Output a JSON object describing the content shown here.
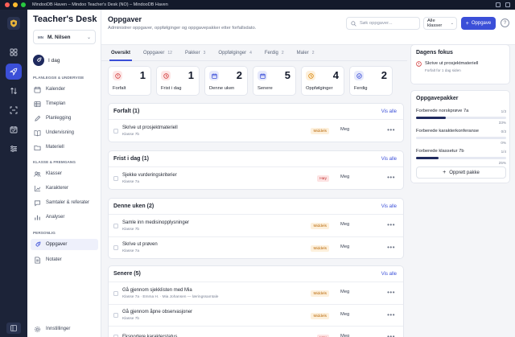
{
  "window": {
    "title": "MindooDB Haven – Mindoo Teacher's Desk (NO) – MindooDB Haven"
  },
  "brand": "Teacher's Desk",
  "user": {
    "initials": "MN",
    "name": "M. Nilsen"
  },
  "rail": {
    "icons": [
      "grid-icon",
      "rocket-icon",
      "arrows-icon",
      "scan-icon",
      "calendar-check-icon",
      "sliders-icon"
    ],
    "active_index": 1
  },
  "sidebar": {
    "today": "I dag",
    "sections": [
      {
        "title": "PLANLEGGE & UNDERVISE",
        "items": [
          "Kalender",
          "Timeplan",
          "Planlegging",
          "Undervisning",
          "Materiell"
        ]
      },
      {
        "title": "KLASSE & FREMGANG",
        "items": [
          "Klasser",
          "Karakterer",
          "Samtaler & referater",
          "Analyser"
        ]
      },
      {
        "title": "PERSONLIG",
        "items": [
          "Oppgaver",
          "Notater"
        ]
      }
    ],
    "active_item": "Oppgaver",
    "settings": "Innstillinger"
  },
  "header": {
    "title": "Oppgaver",
    "subtitle": "Administrer oppgaver, oppfølginger og oppgavepakker etter forfallsdato.",
    "search_placeholder": "Søk oppgaver...",
    "class_filter": "Alle klasser",
    "new_button": "Oppgave"
  },
  "tabs": [
    {
      "label": "Oversikt",
      "count": ""
    },
    {
      "label": "Oppgaver",
      "count": "12"
    },
    {
      "label": "Pakker",
      "count": "3"
    },
    {
      "label": "Oppfølginger",
      "count": "4"
    },
    {
      "label": "Ferdig",
      "count": "2"
    },
    {
      "label": "Maler",
      "count": "2"
    }
  ],
  "stats": [
    {
      "label": "Forfalt",
      "value": "1",
      "color": "#d23c3c",
      "bg": "#fde6e6"
    },
    {
      "label": "Frist i dag",
      "value": "1",
      "color": "#d23c3c",
      "bg": "#fde6e6"
    },
    {
      "label": "Denne uken",
      "value": "2",
      "color": "#3b4fd8",
      "bg": "#e6e9fb"
    },
    {
      "label": "Senere",
      "value": "5",
      "color": "#3b4fd8",
      "bg": "#e6e9fb"
    },
    {
      "label": "Oppfølginger",
      "value": "4",
      "color": "#d9870b",
      "bg": "#fdf0dc"
    },
    {
      "label": "Ferdig",
      "value": "2",
      "color": "#3b4fd8",
      "bg": "#e6e9fb"
    }
  ],
  "view_all": "Vis alle",
  "groups": [
    {
      "title": "Forfalt (1)",
      "tasks": [
        {
          "name": "Skrive ut prosjektmateriell",
          "sub": "Klasse 7b",
          "priority": "Middels",
          "level": "med",
          "owner": "Meg"
        }
      ]
    },
    {
      "title": "Frist i dag (1)",
      "tasks": [
        {
          "name": "Sjekke vurderingskriterier",
          "sub": "Klasse 7a",
          "priority": "Høy",
          "level": "high",
          "owner": "Meg"
        }
      ]
    },
    {
      "title": "Denne uken (2)",
      "tasks": [
        {
          "name": "Samle inn medisinopplysninger",
          "sub": "Klasse 7b",
          "priority": "Middels",
          "level": "med",
          "owner": "Meg"
        },
        {
          "name": "Skrive ut prøven",
          "sub": "Klasse 7a",
          "priority": "Middels",
          "level": "med",
          "owner": "Meg"
        }
      ]
    },
    {
      "title": "Senere (5)",
      "tasks": [
        {
          "name": "Gå gjennom sjekklisten med Mia",
          "sub": "Klasse 7a · Emma H. · Mia Johansen — læringssamtale",
          "priority": "Middels",
          "level": "med",
          "owner": "Meg"
        },
        {
          "name": "Gå gjennom åpne observasjoner",
          "sub": "Klasse 7b",
          "priority": "Middels",
          "level": "med",
          "owner": "Meg"
        },
        {
          "name": "Eksportere karakterstatus",
          "sub": "",
          "priority": "Høy",
          "level": "high",
          "owner": "Meg"
        }
      ]
    }
  ],
  "focus": {
    "title": "Dagens fokus",
    "item": "Skrive ut prosjektmateriell",
    "detail": "Forfalt for 1 dag siden"
  },
  "packages": {
    "title": "Oppgavepakker",
    "items": [
      {
        "name": "Forberede norskprøve 7a",
        "count": "1/3",
        "percent": "33%",
        "fraction": 0.33
      },
      {
        "name": "Forberede karakterkonferanse",
        "count": "0/3",
        "percent": "0%",
        "fraction": 0
      },
      {
        "name": "Forberede klassetur 7b",
        "count": "1/4",
        "percent": "25%",
        "fraction": 0.25
      }
    ],
    "create": "Opprett pakke"
  }
}
